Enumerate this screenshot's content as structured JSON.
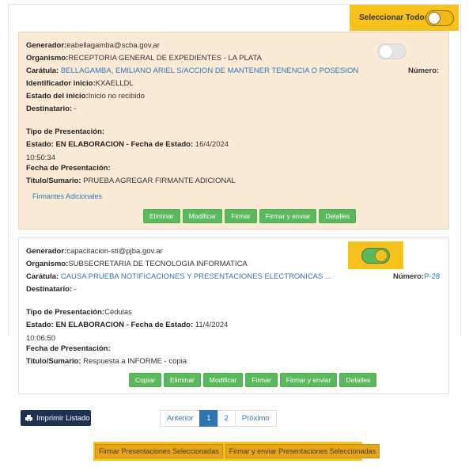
{
  "select_all": {
    "label": "Seleccionar Todos",
    "checked": false
  },
  "cards": [
    {
      "selected": false,
      "generador_label": "Generador:",
      "generador": "eabellagamba@scba.gov.ar",
      "organismo_label": "Organismo:",
      "organismo": "RECEPTORIA GENERAL DE EXPEDIENTES - LA PLATA",
      "caratula_label": "Carátula:",
      "caratula": "BELLAGAMBA, EMILIANO ARIEL S/ACCION DE MANTENER TENENCIA O POSESION",
      "numero_label": "Número:",
      "numero": "",
      "identificador_label": "Identificador inicio:",
      "identificador": "KXAELLDL",
      "estado_inicio_label": "Estado del inicio:",
      "estado_inicio": "Inicio no recibido",
      "destinatario_label": "Destinatario:",
      "destinatario": " -",
      "tipo_label": "Tipo de Presentación:",
      "tipo": "",
      "estado_label": "Estado: EN ELABORACION - Fecha de Estado:",
      "estado_fecha": " 16/4/2024",
      "hora": "10:50:34",
      "fecha_pres_label": "Fecha de Presentación:",
      "titulo_label": "Titulo/Sumario:",
      "titulo": " PRUEBA AGREGAR FIRMANTE ADICIONAL",
      "firmantes_link": "Firmantes Adicionales",
      "buttons": [
        "Eliminar",
        "Modificar",
        "Firmar",
        "Firmar y enviar",
        "Detalles"
      ]
    },
    {
      "selected": true,
      "generador_label": "Generador:",
      "generador": "capacitacion-sti@pjba.gov.ar",
      "organismo_label": "Organismo:",
      "organismo": "SUBSECRETARIA DE TECNOLOGIA INFORMATICA",
      "caratula_label": "Carátula:",
      "caratula": "CAUSA PRUEBA NOTIFICACIONES Y PRESENTACIONES ELECTRONICAS ...",
      "numero_label": "Número:",
      "numero": "P-28",
      "destinatario_label": "Destinatario:",
      "destinatario": " -",
      "tipo_label": "Tipo de Presentación:",
      "tipo": "Cédulas",
      "estado_label": "Estado: EN ELABORACION - Fecha de Estado:",
      "estado_fecha": " 11/4/2024",
      "hora": "10:06:50",
      "fecha_pres_label": "Fecha de Presentación:",
      "titulo_label": "Titulo/Sumario:",
      "titulo": " Respuesta a INFORME - copia",
      "buttons": [
        "Copiar",
        "Eliminar",
        "Modificar",
        "Firmar",
        "Firmar y enviar",
        "Detalles"
      ]
    }
  ],
  "print_button": "Imprimir Listado",
  "pagination": {
    "prev": "Anterior",
    "pages": [
      "1",
      "2"
    ],
    "next": "Próximo",
    "current": "1"
  },
  "bulk_actions": {
    "sign": "Firmar Presentaciones Seleccionadas",
    "sign_send": "Firmar y enviar Presentaciones Seleccionadas"
  },
  "colors": {
    "accent_yellow": "#f7c21c",
    "green": "#5cb85c",
    "card_bg": "#fbebd6",
    "link": "#3174b8",
    "navy": "#1f3150"
  }
}
